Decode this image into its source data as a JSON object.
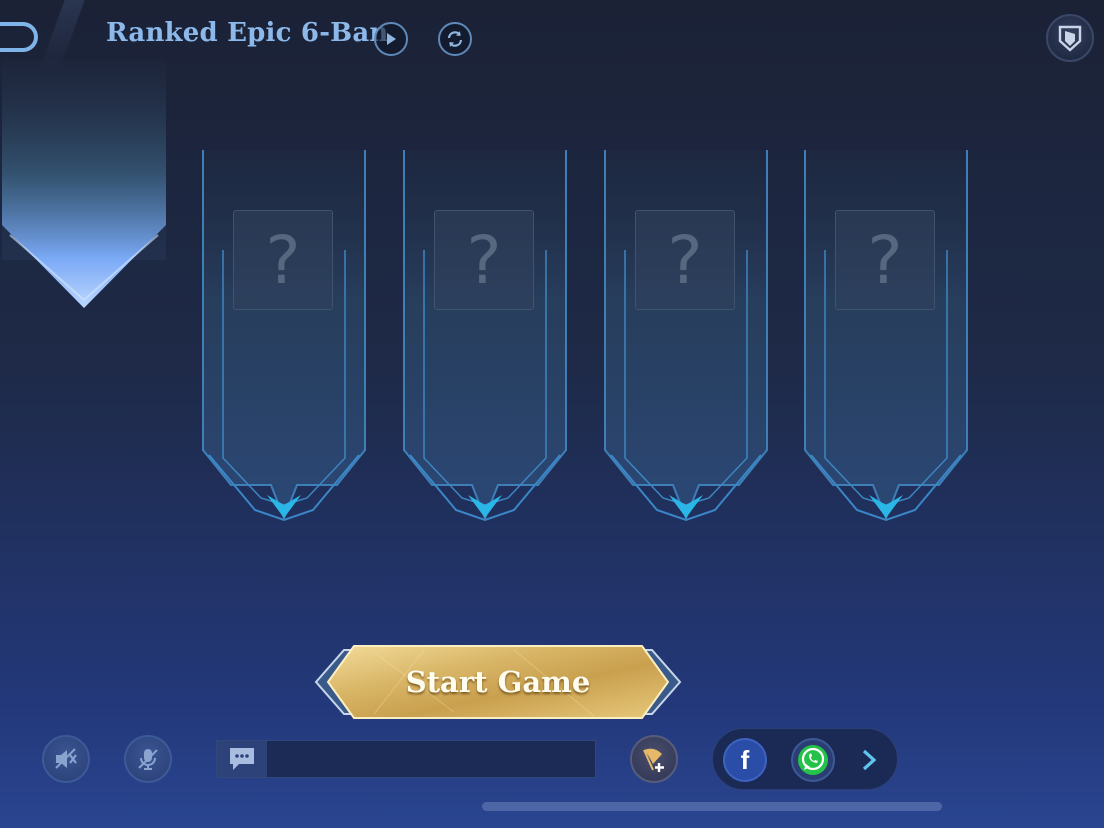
{
  "header": {
    "mode_title": "Ranked Epic 6-Ban"
  },
  "hero_slots": [
    {
      "placeholder": "?"
    },
    {
      "placeholder": "?"
    },
    {
      "placeholder": "?"
    },
    {
      "placeholder": "?"
    }
  ],
  "start_button": {
    "label": "Start Game"
  },
  "colors": {
    "accent_blue": "#8db8ea",
    "slot_glow": "#2ab7e8",
    "gold": "#d8b566"
  },
  "icons": {
    "back": "back-arrow-icon",
    "play": "play-icon",
    "refresh": "refresh-icon",
    "shield": "shield-icon",
    "speaker_muted": "speaker-muted-icon",
    "mic_muted": "mic-muted-icon",
    "chat": "chat-bubble-icon",
    "invite": "flag-plus-icon",
    "facebook": "facebook-icon",
    "whatsapp": "whatsapp-icon",
    "more": "chevron-right-icon"
  },
  "share": {
    "facebook_glyph": "f"
  }
}
